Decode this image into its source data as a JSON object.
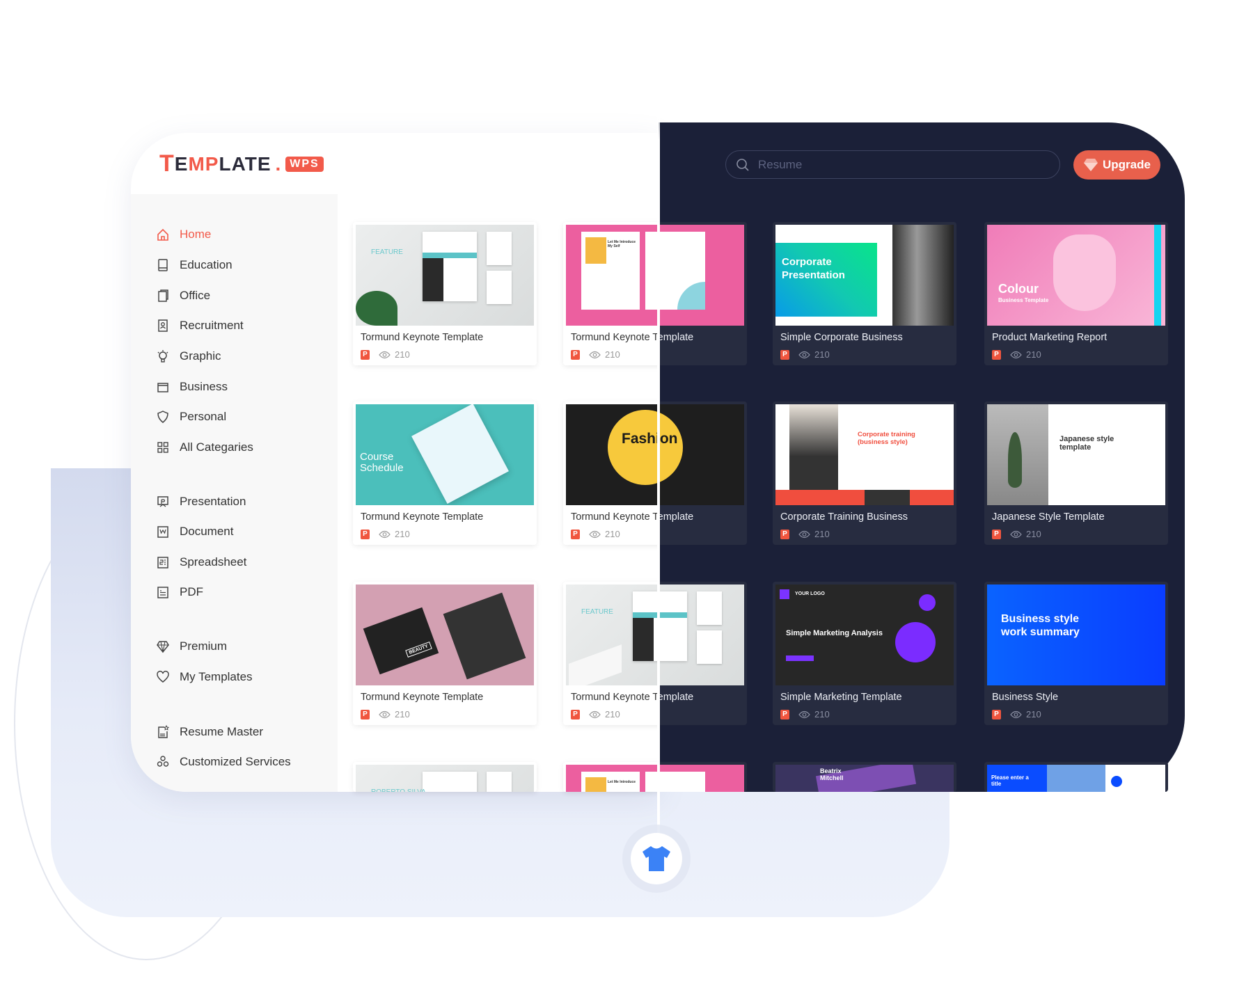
{
  "logo": {
    "t": "T",
    "rest1": "E",
    "m": "MP",
    "rest2": "LATE",
    "dot": ".",
    "badge": "WPS"
  },
  "search": {
    "placeholder": "Resume"
  },
  "upgrade": {
    "label": "Upgrade",
    "icon": "diamond-icon"
  },
  "colors": {
    "accent": "#f25a4a",
    "dark_bg": "#1b2038",
    "dark_card": "#272c40",
    "upgrade": "#e8604c",
    "shirt": "#3b82f6"
  },
  "sidebar": {
    "items": [
      {
        "label": "Home",
        "icon": "home-icon",
        "active": true
      },
      {
        "label": "Education",
        "icon": "book-icon"
      },
      {
        "label": "Office",
        "icon": "documents-icon"
      },
      {
        "label": "Recruitment",
        "icon": "id-card-icon"
      },
      {
        "label": "Graphic",
        "icon": "lightbulb-icon"
      },
      {
        "label": "Business",
        "icon": "briefcase-icon"
      },
      {
        "label": "Personal",
        "icon": "shield-heart-icon"
      },
      {
        "label": "All Categaries",
        "icon": "grid-icon"
      },
      {
        "label": "Presentation",
        "icon": "presentation-icon"
      },
      {
        "label": "Document",
        "icon": "document-icon"
      },
      {
        "label": "Spreadsheet",
        "icon": "spreadsheet-icon"
      },
      {
        "label": "PDF",
        "icon": "pdf-icon"
      },
      {
        "label": "Premium",
        "icon": "diamond-icon"
      },
      {
        "label": "My Templates",
        "icon": "heart-icon"
      },
      {
        "label": "Resume Master",
        "icon": "resume-icon"
      },
      {
        "label": "Customized Services",
        "icon": "services-icon"
      }
    ]
  },
  "cards": [
    {
      "title": "Tormund Keynote Template",
      "views": "210",
      "thumb": "resume-gray",
      "thumb_text": "FEATURE"
    },
    {
      "title": "Tormund Keynote Template",
      "views": "210",
      "thumb": "resume-pink",
      "thumb_text": "Let Me Introduce My Self"
    },
    {
      "title": "Simple Corporate Business",
      "views": "210",
      "thumb": "corporate",
      "thumb_text": "Corporate Presentation"
    },
    {
      "title": "Product Marketing Report",
      "views": "210",
      "thumb": "chair",
      "thumb_text": "Colour",
      "thumb_sub": "Business Template"
    },
    {
      "title": "Tormund Keynote Template",
      "views": "210",
      "thumb": "course",
      "thumb_text": "Course Schedule"
    },
    {
      "title": "Tormund Keynote Template",
      "views": "210",
      "thumb": "fashion",
      "thumb_text": "Fashion"
    },
    {
      "title": "Corporate Training Business",
      "views": "210",
      "thumb": "training",
      "thumb_text": "Corporate training (business style)"
    },
    {
      "title": "Japanese Style Template",
      "views": "210",
      "thumb": "japanese",
      "thumb_text": "Japanese style template"
    },
    {
      "title": "Tormund Keynote Template",
      "views": "210",
      "thumb": "beauty",
      "thumb_text": "BEAUTY"
    },
    {
      "title": "Tormund Keynote Template",
      "views": "210",
      "thumb": "resume-gray2",
      "thumb_text": "FEATURE"
    },
    {
      "title": "Simple Marketing Template",
      "views": "210",
      "thumb": "marketing",
      "thumb_text": "Simple Marketing Analysis",
      "thumb_sub": "YOUR LOGO"
    },
    {
      "title": "Business Style",
      "views": "210",
      "thumb": "blue",
      "thumb_text": "Business style work summary"
    },
    {
      "thumb": "resume-gray",
      "thumb_text": "ROBERTO SILVA"
    },
    {
      "thumb": "resume-pink",
      "thumb_text": "Let Me Introduce"
    },
    {
      "thumb": "purple",
      "thumb_text": "Beatrix Mitchell"
    },
    {
      "thumb": "blue-title",
      "thumb_text": "Please enter a title"
    }
  ]
}
